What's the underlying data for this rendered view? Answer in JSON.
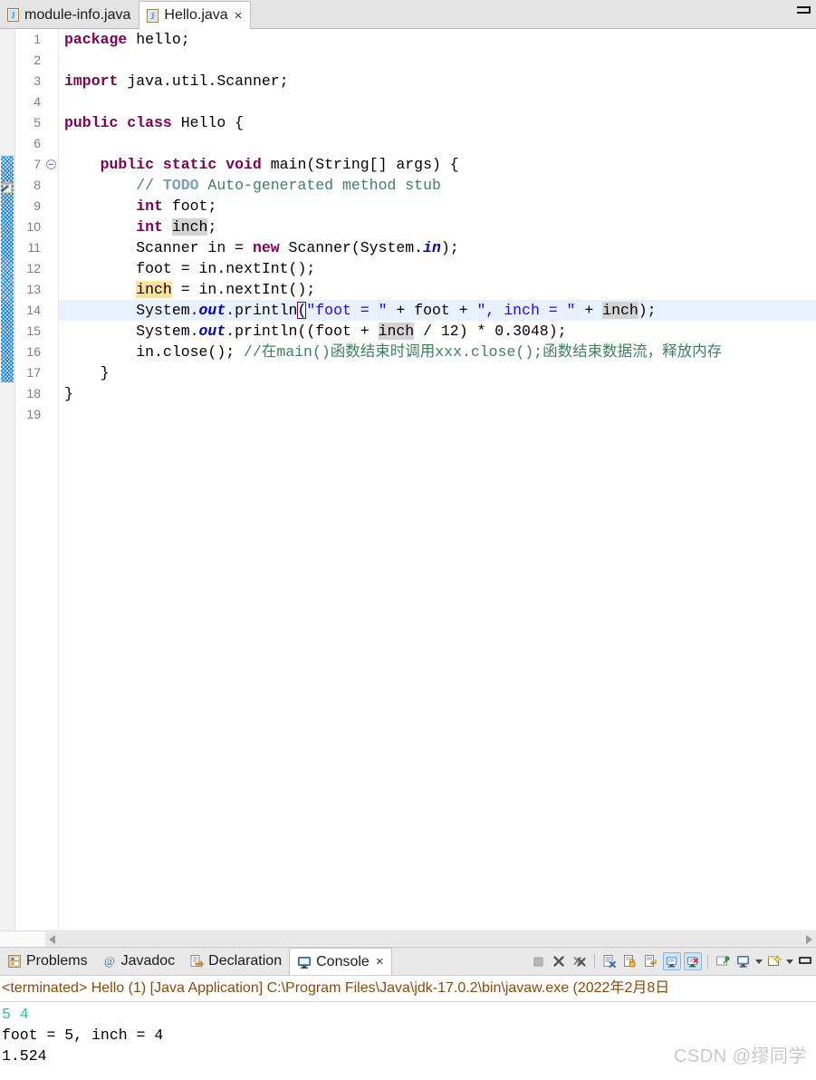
{
  "window": {
    "minimize_label": "minimize"
  },
  "editor_tabs": [
    {
      "label": "module-info.java",
      "icon": "java-file-icon",
      "active": false,
      "closable": false
    },
    {
      "label": "Hello.java",
      "icon": "java-file-icon",
      "active": true,
      "closable": true,
      "close_label": "×"
    }
  ],
  "gutter": {
    "line_numbers": [
      "1",
      "2",
      "3",
      "4",
      "5",
      "6",
      "7",
      "8",
      "9",
      "10",
      "11",
      "12",
      "13",
      "14",
      "15",
      "16",
      "17",
      "18",
      "19"
    ],
    "fold_marker_line": 7,
    "todo_marker_line": 8
  },
  "code": {
    "current_line": 14,
    "lines": [
      {
        "n": 1,
        "tokens": [
          {
            "t": "package",
            "c": "kw"
          },
          {
            "t": " hello;",
            "c": "plain"
          }
        ]
      },
      {
        "n": 2,
        "tokens": []
      },
      {
        "n": 3,
        "tokens": [
          {
            "t": "import",
            "c": "kw"
          },
          {
            "t": " java.util.Scanner;",
            "c": "plain"
          }
        ]
      },
      {
        "n": 4,
        "tokens": []
      },
      {
        "n": 5,
        "tokens": [
          {
            "t": "public class",
            "c": "kw"
          },
          {
            "t": " Hello {",
            "c": "plain"
          }
        ]
      },
      {
        "n": 6,
        "tokens": []
      },
      {
        "n": 7,
        "tokens": [
          {
            "t": "    ",
            "c": "plain"
          },
          {
            "t": "public static void",
            "c": "kw"
          },
          {
            "t": " main(String[] args) {",
            "c": "plain"
          }
        ]
      },
      {
        "n": 8,
        "tokens": [
          {
            "t": "        // ",
            "c": "cmt"
          },
          {
            "t": "TODO",
            "c": "todo"
          },
          {
            "t": " Auto-generated method stub",
            "c": "cmt"
          }
        ]
      },
      {
        "n": 9,
        "tokens": [
          {
            "t": "        ",
            "c": "plain"
          },
          {
            "t": "int",
            "c": "kw"
          },
          {
            "t": " foot;",
            "c": "plain"
          }
        ]
      },
      {
        "n": 10,
        "tokens": [
          {
            "t": "        ",
            "c": "plain"
          },
          {
            "t": "int",
            "c": "kw"
          },
          {
            "t": " ",
            "c": "plain"
          },
          {
            "t": "inch",
            "c": "plain hl-gray"
          },
          {
            "t": ";",
            "c": "plain"
          }
        ]
      },
      {
        "n": 11,
        "tokens": [
          {
            "t": "        Scanner in = ",
            "c": "plain"
          },
          {
            "t": "new",
            "c": "kw"
          },
          {
            "t": " Scanner(System.",
            "c": "plain"
          },
          {
            "t": "in",
            "c": "fieldi"
          },
          {
            "t": ");",
            "c": "plain"
          }
        ]
      },
      {
        "n": 12,
        "tokens": [
          {
            "t": "        foot = in.nextInt();",
            "c": "plain"
          }
        ]
      },
      {
        "n": 13,
        "tokens": [
          {
            "t": "        ",
            "c": "plain"
          },
          {
            "t": "inch",
            "c": "plain hl-orange"
          },
          {
            "t": " = in.nextInt();",
            "c": "plain"
          }
        ]
      },
      {
        "n": 14,
        "tokens": [
          {
            "t": "        System.",
            "c": "plain"
          },
          {
            "t": "out",
            "c": "fieldi"
          },
          {
            "t": ".println",
            "c": "plain"
          },
          {
            "t": "CARET",
            "c": "caret"
          },
          {
            "t": "(",
            "c": "plain brk"
          },
          {
            "t": "\"foot = \"",
            "c": "str"
          },
          {
            "t": " + foot + ",
            "c": "plain"
          },
          {
            "t": "\", inch = \"",
            "c": "str"
          },
          {
            "t": " + ",
            "c": "plain"
          },
          {
            "t": "inch",
            "c": "plain hl-gray"
          },
          {
            "t": ");",
            "c": "plain"
          }
        ]
      },
      {
        "n": 15,
        "tokens": [
          {
            "t": "        System.",
            "c": "plain"
          },
          {
            "t": "out",
            "c": "fieldi"
          },
          {
            "t": ".println((foot + ",
            "c": "plain"
          },
          {
            "t": "inch",
            "c": "plain hl-gray"
          },
          {
            "t": " / 12) * 0.3048);",
            "c": "plain"
          }
        ]
      },
      {
        "n": 16,
        "tokens": [
          {
            "t": "        in.close(); ",
            "c": "plain"
          },
          {
            "t": "//在main()函数结束时调用xxx.close();函数结束数据流，释放内存",
            "c": "cmt"
          }
        ]
      },
      {
        "n": 17,
        "tokens": [
          {
            "t": "    }",
            "c": "plain"
          }
        ]
      },
      {
        "n": 18,
        "tokens": [
          {
            "t": "}",
            "c": "plain"
          }
        ]
      },
      {
        "n": 19,
        "tokens": []
      }
    ]
  },
  "panel_tabs": [
    {
      "label": "Problems",
      "icon": "problems-icon",
      "active": false,
      "closable": false
    },
    {
      "label": "Javadoc",
      "icon": "javadoc-icon",
      "active": false,
      "closable": false
    },
    {
      "label": "Declaration",
      "icon": "declaration-icon",
      "active": false,
      "closable": false
    },
    {
      "label": "Console",
      "icon": "console-icon",
      "active": true,
      "closable": true,
      "close_label": "×"
    }
  ],
  "console_toolbar": [
    {
      "name": "terminate-button",
      "icon": "stop-square-icon",
      "state": "disabled"
    },
    {
      "name": "remove-launch-button",
      "icon": "x-icon",
      "state": "normal"
    },
    {
      "name": "remove-all-launches-button",
      "icon": "xx-icon",
      "state": "normal"
    },
    {
      "name": "separator-1",
      "icon": "separator",
      "state": "normal"
    },
    {
      "name": "clear-console-button",
      "icon": "clear-console-icon",
      "state": "normal"
    },
    {
      "name": "scroll-lock-button",
      "icon": "lock-icon",
      "state": "normal"
    },
    {
      "name": "word-wrap-button",
      "icon": "wrap-icon",
      "state": "normal"
    },
    {
      "name": "show-console-on-output-button",
      "icon": "console-out-icon",
      "state": "toggled"
    },
    {
      "name": "show-console-on-error-button",
      "icon": "console-err-icon",
      "state": "toggled"
    },
    {
      "name": "separator-2",
      "icon": "separator",
      "state": "normal"
    },
    {
      "name": "pin-console-button",
      "icon": "pin-icon",
      "state": "normal"
    },
    {
      "name": "display-selected-console-button",
      "icon": "display-console-icon",
      "state": "normal"
    },
    {
      "name": "display-console-menu-caret",
      "icon": "chevron-down-icon",
      "state": "normal"
    },
    {
      "name": "open-console-button",
      "icon": "new-console-icon",
      "state": "normal"
    },
    {
      "name": "open-console-menu-caret",
      "icon": "chevron-down-icon",
      "state": "normal"
    }
  ],
  "console": {
    "header": "<terminated> Hello (1) [Java Application] C:\\Program Files\\Java\\jdk-17.0.2\\bin\\javaw.exe  (2022年2月8日",
    "lines": [
      {
        "text": "5 4",
        "kind": "input"
      },
      {
        "text": "foot = 5, inch = 4",
        "kind": "out"
      },
      {
        "text": "1.524",
        "kind": "out"
      }
    ]
  },
  "watermark": "CSDN @缪同学"
}
